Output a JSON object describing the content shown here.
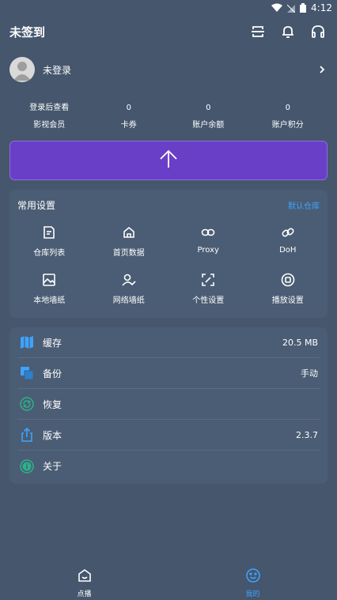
{
  "status_bar": {
    "time": "4:12"
  },
  "header": {
    "title": "未签到",
    "icons": [
      "scan-icon",
      "bell-icon",
      "headphones-icon"
    ]
  },
  "user": {
    "name": "未登录"
  },
  "stats": [
    {
      "value": "登录后查看",
      "label": "影视会员"
    },
    {
      "value": "0",
      "label": "卡券"
    },
    {
      "value": "0",
      "label": "账户余额"
    },
    {
      "value": "0",
      "label": "账户积分"
    }
  ],
  "action_button": {
    "icon": "arrow-up-icon"
  },
  "common_settings": {
    "title": "常用设置",
    "link": "默认仓库",
    "items": [
      {
        "label": "仓库列表",
        "icon": "repo-list-icon"
      },
      {
        "label": "首页数据",
        "icon": "home-icon"
      },
      {
        "label": "Proxy",
        "icon": "link-icon"
      },
      {
        "label": "DoH",
        "icon": "chain-icon"
      },
      {
        "label": "本地墙纸",
        "icon": "image-icon"
      },
      {
        "label": "网络墙纸",
        "icon": "user-check-icon"
      },
      {
        "label": "个性设置",
        "icon": "expand-icon"
      },
      {
        "label": "播放设置",
        "icon": "play-circle-icon"
      }
    ]
  },
  "info_list": [
    {
      "label": "缓存",
      "value": "20.5 MB",
      "icon": "map-icon"
    },
    {
      "label": "备份",
      "value": "手动",
      "icon": "backup-icon"
    },
    {
      "label": "恢复",
      "value": "",
      "icon": "restore-icon"
    },
    {
      "label": "版本",
      "value": "2.3.7",
      "icon": "share-icon"
    },
    {
      "label": "关于",
      "value": "",
      "icon": "info-icon"
    }
  ],
  "bottom_nav": [
    {
      "label": "点播",
      "icon": "tv-icon",
      "active": false
    },
    {
      "label": "我的",
      "icon": "smile-icon",
      "active": true
    }
  ],
  "colors": {
    "background": "#45566d",
    "card": "#4b5d74",
    "accent": "#3ea3ff",
    "action": "#6a3fc7"
  }
}
